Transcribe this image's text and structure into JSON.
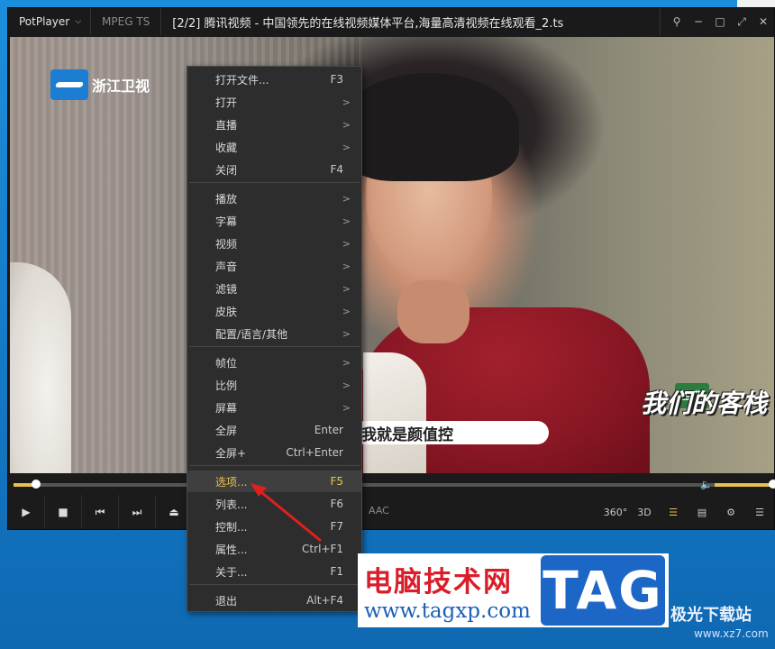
{
  "window": {
    "app_name": "PotPlayer",
    "format": "MPEG TS",
    "title": "[2/2] 腾讯视频 - 中国领先的在线视频媒体平台,海量高清视频在线观看_2.ts"
  },
  "video": {
    "channel_logo": "浙江卫视",
    "subtitle": "我就是颜值控",
    "show_logo": "我们的客栈",
    "show_badge": "金典"
  },
  "playback": {
    "progress": 0.03,
    "volume": 0.95,
    "codec": "AAC"
  },
  "controls": {
    "right": [
      "360°",
      "3D"
    ]
  },
  "menu": {
    "items": [
      {
        "label": "打开文件...",
        "shortcut": "F3"
      },
      {
        "label": "打开",
        "shortcut": ">"
      },
      {
        "label": "直播",
        "shortcut": ">"
      },
      {
        "label": "收藏",
        "shortcut": ">"
      },
      {
        "label": "关闭",
        "shortcut": "F4"
      },
      {
        "label": "播放",
        "shortcut": ">"
      },
      {
        "label": "字幕",
        "shortcut": ">"
      },
      {
        "label": "视频",
        "shortcut": ">"
      },
      {
        "label": "声音",
        "shortcut": ">"
      },
      {
        "label": "滤镜",
        "shortcut": ">"
      },
      {
        "label": "皮肤",
        "shortcut": ">"
      },
      {
        "label": "配置/语言/其他",
        "shortcut": ">"
      },
      {
        "label": "帧位",
        "shortcut": ">"
      },
      {
        "label": "比例",
        "shortcut": ">"
      },
      {
        "label": "屏幕",
        "shortcut": ">"
      },
      {
        "label": "全屏",
        "shortcut": "Enter"
      },
      {
        "label": "全屏+",
        "shortcut": "Ctrl+Enter"
      },
      {
        "label": "选项...",
        "shortcut": "F5"
      },
      {
        "label": "列表...",
        "shortcut": "F6"
      },
      {
        "label": "控制...",
        "shortcut": "F7"
      },
      {
        "label": "属性...",
        "shortcut": "Ctrl+F1"
      },
      {
        "label": "关于...",
        "shortcut": "F1"
      },
      {
        "label": "退出",
        "shortcut": "Alt+F4"
      }
    ],
    "highlighted": "选项..."
  },
  "watermark": {
    "site_name": "电脑技术网",
    "url": "www.tagxp.com",
    "tag": "TAG",
    "secondary": "极光下载站",
    "secondary_url": "www.xz7.com"
  },
  "colors": {
    "accent": "#f0c24a",
    "menu_bg": "#2d2d2d",
    "annotation_arrow": "#e0201e",
    "desktop": "#1688d6"
  }
}
